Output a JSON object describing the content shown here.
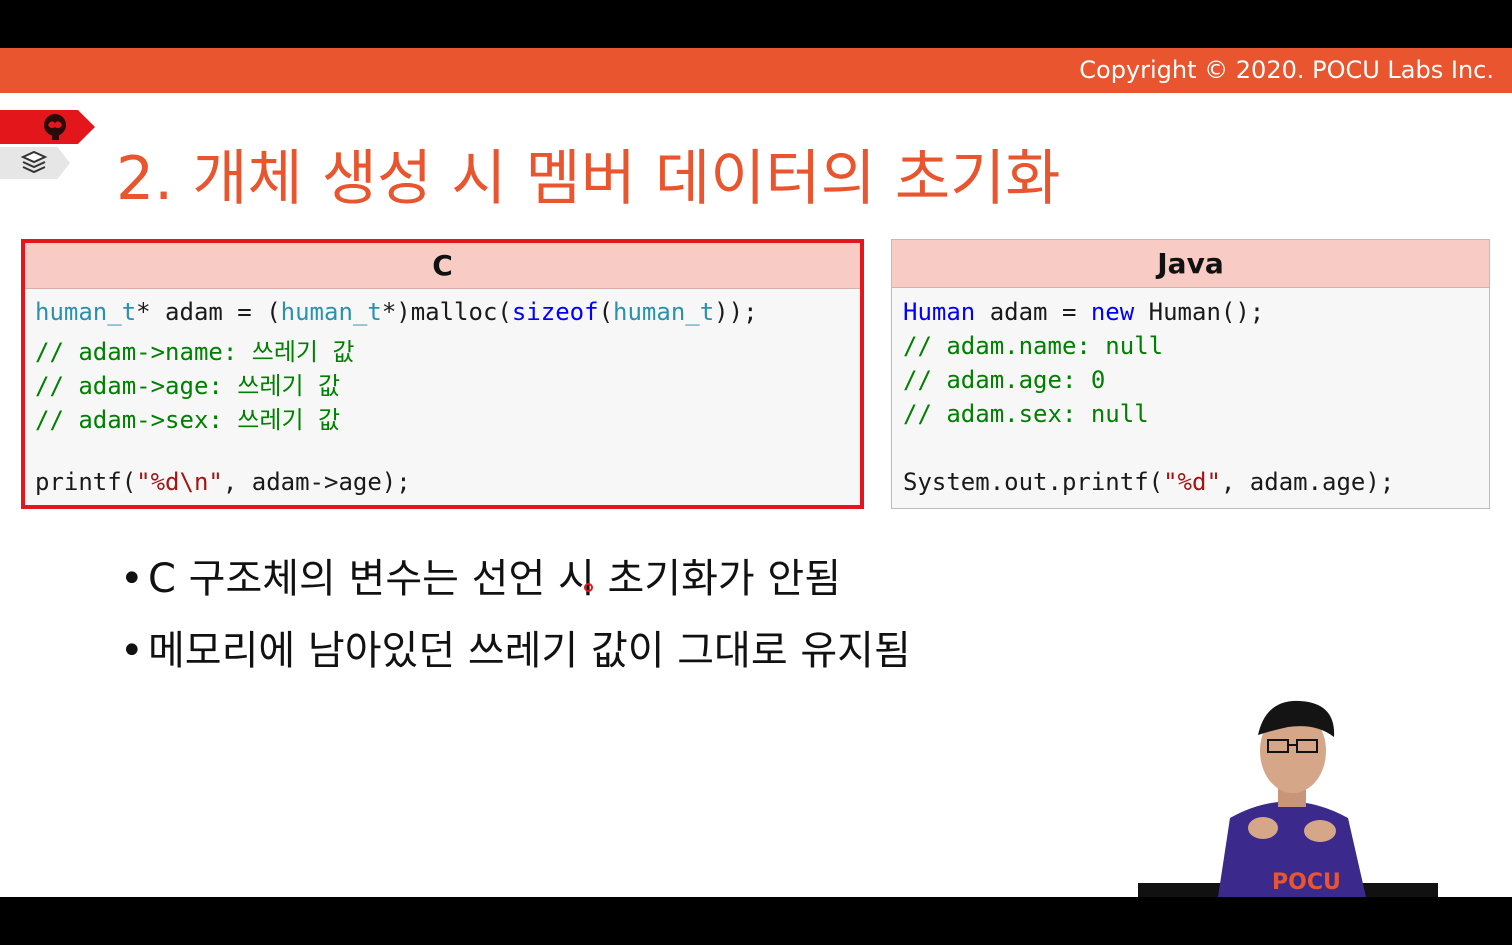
{
  "copyright": "Copyright © 2020. POCU Labs Inc.",
  "title": "2. 개체 생성 시 멤버 데이터의 초기화",
  "icons": {
    "brain": "brain-icon",
    "book": "book-stack-icon"
  },
  "c_panel": {
    "header": "C",
    "line1": {
      "t1": "human_t",
      "t2": "* adam = (",
      "t3": "human_t",
      "t4": "*)malloc(",
      "t5": "sizeof",
      "t6": "(",
      "t7": "human_t",
      "t8": "));"
    },
    "comment1": "// adam->name: 쓰레기 값",
    "comment2": "// adam->age: 쓰레기 값",
    "comment3": "// adam->sex: 쓰레기 값",
    "print": {
      "p1": "printf(",
      "p2": "\"%d\\n\"",
      "p3": ", adam->age);"
    }
  },
  "java_panel": {
    "header": "Java",
    "line1": {
      "t1": "Human",
      "t2": " adam = ",
      "t3": "new",
      "t4": " Human();"
    },
    "comment1": "// adam.name: null",
    "comment2": "// adam.age: 0",
    "comment3": "// adam.sex: null",
    "print": {
      "p1": "System.out.printf(",
      "p2": "\"%d\"",
      "p3": ", adam.age);"
    }
  },
  "bullets": [
    "C 구조체의 변수는 선언 시 초기화가 안됨",
    "메모리에 남아있던 쓰레기 값이 그대로 유지됨"
  ],
  "bullet_marker": "•",
  "presenter_shirt_text": "POCU",
  "colors": {
    "accent_orange": "#e8552e",
    "highlight_red": "#e3161b",
    "header_pink": "#f8cbc4",
    "comment_green": "#008000",
    "type_teal": "#2b91af",
    "keyword_blue": "#0000ff",
    "string_red": "#a31515"
  }
}
